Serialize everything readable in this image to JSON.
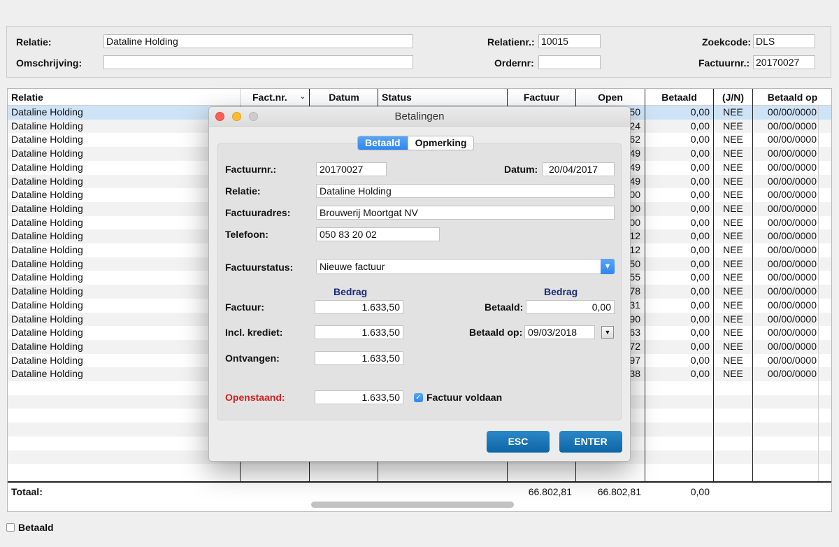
{
  "filters": {
    "relatie_label": "Relatie:",
    "relatie_value": "Dataline Holding",
    "omschrijving_label": "Omschrijving:",
    "omschrijving_value": "",
    "relatienr_label": "Relatienr.:",
    "relatienr_value": "10015",
    "ordernr_label": "Ordernr:",
    "ordernr_value": "",
    "zoekcode_label": "Zoekcode:",
    "zoekcode_value": "DLS",
    "factuurnr_label": "Factuurnr.:",
    "factuurnr_value": "20170027"
  },
  "table": {
    "columns": {
      "relatie": "Relatie",
      "factnr": "Fact.nr.",
      "datum": "Datum",
      "status": "Status",
      "factuur": "Factuur",
      "open": "Open",
      "betaald": "Betaald",
      "jn": "(J/N)",
      "betaald_op": "Betaald op"
    },
    "sort_icon": "chevron-down-icon",
    "rows": [
      {
        "relatie": "Dataline Holding",
        "open_tail": "50",
        "betaald": "0,00",
        "jn": "NEE",
        "betaald_op": "00/00/0000"
      },
      {
        "relatie": "Dataline Holding",
        "open_tail": "24",
        "betaald": "0,00",
        "jn": "NEE",
        "betaald_op": "00/00/0000"
      },
      {
        "relatie": "Dataline Holding",
        "open_tail": "62",
        "betaald": "0,00",
        "jn": "NEE",
        "betaald_op": "00/00/0000"
      },
      {
        "relatie": "Dataline Holding",
        "open_tail": "49",
        "betaald": "0,00",
        "jn": "NEE",
        "betaald_op": "00/00/0000"
      },
      {
        "relatie": "Dataline Holding",
        "open_tail": "49",
        "betaald": "0,00",
        "jn": "NEE",
        "betaald_op": "00/00/0000"
      },
      {
        "relatie": "Dataline Holding",
        "open_tail": "49",
        "betaald": "0,00",
        "jn": "NEE",
        "betaald_op": "00/00/0000"
      },
      {
        "relatie": "Dataline Holding",
        "open_tail": "00",
        "betaald": "0,00",
        "jn": "NEE",
        "betaald_op": "00/00/0000"
      },
      {
        "relatie": "Dataline Holding",
        "open_tail": "00",
        "betaald": "0,00",
        "jn": "NEE",
        "betaald_op": "00/00/0000"
      },
      {
        "relatie": "Dataline Holding",
        "open_tail": "00",
        "betaald": "0,00",
        "jn": "NEE",
        "betaald_op": "00/00/0000"
      },
      {
        "relatie": "Dataline Holding",
        "open_tail": "12",
        "betaald": "0,00",
        "jn": "NEE",
        "betaald_op": "00/00/0000"
      },
      {
        "relatie": "Dataline Holding",
        "open_tail": "12",
        "betaald": "0,00",
        "jn": "NEE",
        "betaald_op": "00/00/0000"
      },
      {
        "relatie": "Dataline Holding",
        "open_tail": "50",
        "betaald": "0,00",
        "jn": "NEE",
        "betaald_op": "00/00/0000"
      },
      {
        "relatie": "Dataline Holding",
        "open_tail": "55",
        "betaald": "0,00",
        "jn": "NEE",
        "betaald_op": "00/00/0000"
      },
      {
        "relatie": "Dataline Holding",
        "open_tail": "78",
        "betaald": "0,00",
        "jn": "NEE",
        "betaald_op": "00/00/0000"
      },
      {
        "relatie": "Dataline Holding",
        "open_tail": "31",
        "betaald": "0,00",
        "jn": "NEE",
        "betaald_op": "00/00/0000"
      },
      {
        "relatie": "Dataline Holding",
        "open_tail": "90",
        "betaald": "0,00",
        "jn": "NEE",
        "betaald_op": "00/00/0000"
      },
      {
        "relatie": "Dataline Holding",
        "open_tail": "63",
        "betaald": "0,00",
        "jn": "NEE",
        "betaald_op": "00/00/0000"
      },
      {
        "relatie": "Dataline Holding",
        "open_tail": "72",
        "betaald": "0,00",
        "jn": "NEE",
        "betaald_op": "00/00/0000"
      },
      {
        "relatie": "Dataline Holding",
        "open_tail": "97",
        "betaald": "0,00",
        "jn": "NEE",
        "betaald_op": "00/00/0000"
      },
      {
        "relatie": "Dataline Holding",
        "open_tail": "38",
        "betaald": "0,00",
        "jn": "NEE",
        "betaald_op": "00/00/0000"
      }
    ],
    "totals": {
      "label": "Totaal:",
      "factuur": "66.802,81",
      "open": "66.802,81",
      "betaald": "0,00"
    }
  },
  "bottom": {
    "betaald_checkbox_label": "Betaald",
    "betaald_checked": false
  },
  "dialog": {
    "title": "Betalingen",
    "tabs": [
      "Betaald",
      "Opmerking"
    ],
    "active_tab": "Betaald",
    "factuurnr_label": "Factuurnr.:",
    "factuurnr_value": "20170027",
    "datum_label": "Datum:",
    "datum_value": "20/04/2017",
    "relatie_label": "Relatie:",
    "relatie_value": "Dataline Holding",
    "factuuradres_label": "Factuuradres:",
    "factuuradres_value": "Brouwerij Moortgat NV",
    "telefoon_label": "Telefoon:",
    "telefoon_value": "050 83 20 02",
    "factuurstatus_label": "Factuurstatus:",
    "factuurstatus_value": "Nieuwe factuur",
    "bedrag_header_left": "Bedrag",
    "bedrag_header_right": "Bedrag",
    "factuur_label": "Factuur:",
    "factuur_value": "1.633,50",
    "incl_krediet_label": "Incl. krediet:",
    "incl_krediet_value": "1.633,50",
    "ontvangen_label": "Ontvangen:",
    "ontvangen_value": "1.633,50",
    "betaald_label": "Betaald:",
    "betaald_value": "0,00",
    "betaald_op_label": "Betaald op:",
    "betaald_op_value": "09/03/2018",
    "openstaand_label": "Openstaand:",
    "openstaand_value": "1.633,50",
    "factuur_voldaan_label": "Factuur voldaan",
    "factuur_voldaan_checked": true,
    "esc_label": "ESC",
    "enter_label": "ENTER"
  },
  "colors": {
    "accent_blue": "#2f86ef",
    "button_blue": "#1a75b8",
    "openstaand_red": "#d42020",
    "bedrag_navy": "#1a2a7a",
    "selected_row": "#cfe3f7"
  }
}
